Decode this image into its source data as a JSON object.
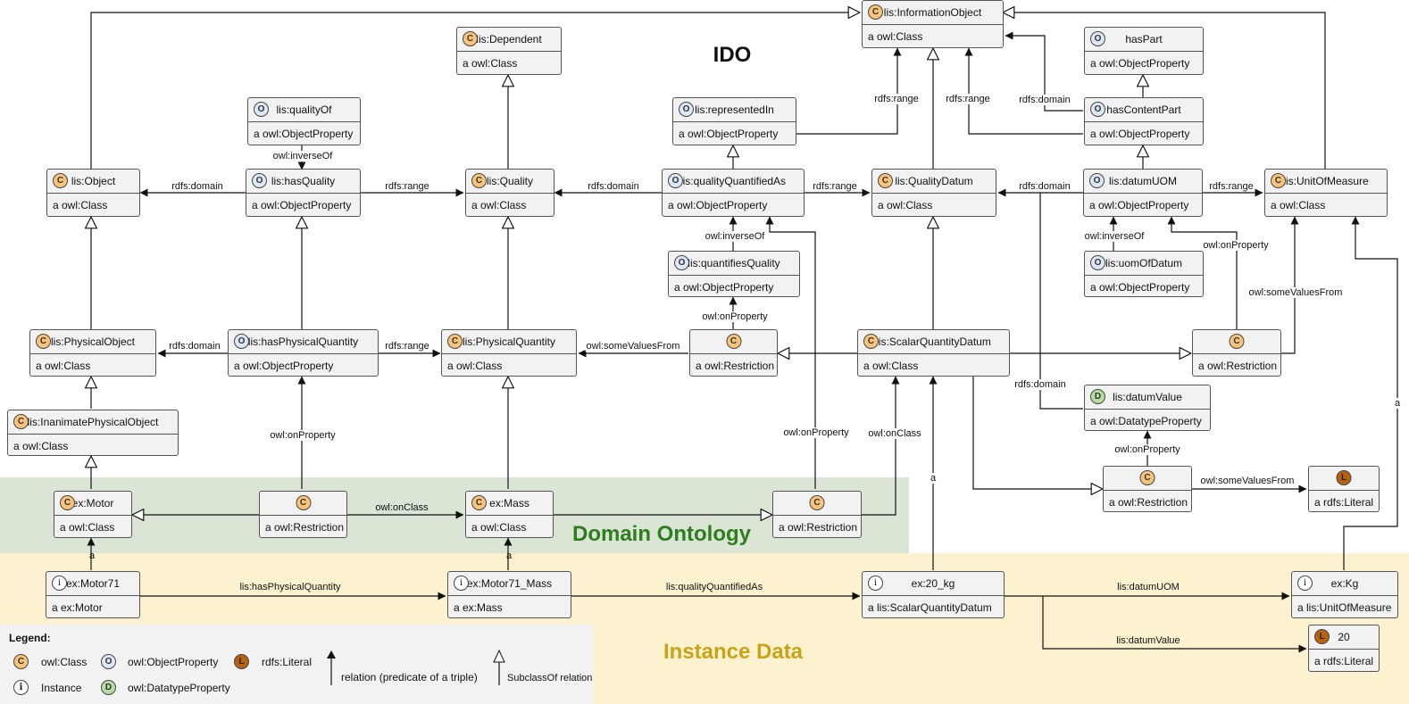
{
  "titles": {
    "ido": "IDO",
    "domain": "Domain Ontology",
    "instance": "Instance Data"
  },
  "colors": {
    "class": "#f9c479",
    "object_property": "#dce7f7",
    "literal": "#b8620f",
    "datatype_property": "#b5dea0",
    "domain_region": "#dae5d6",
    "instance_region": "#fdf2cf",
    "legend_region": "#f2f2f2"
  },
  "nodes": {
    "information_object": {
      "badge": "C",
      "name": "lis:InformationObject",
      "type": "a owl:Class"
    },
    "dependent": {
      "badge": "C",
      "name": "lis:Dependent",
      "type": "a owl:Class"
    },
    "has_part": {
      "badge": "O",
      "name": "hasPart",
      "type": "a owl:ObjectProperty"
    },
    "quality_of": {
      "badge": "O",
      "name": "lis:qualityOf",
      "type": "a owl:ObjectProperty"
    },
    "represented_in": {
      "badge": "O",
      "name": "lis:representedIn",
      "type": "a owl:ObjectProperty"
    },
    "has_content_part": {
      "badge": "O",
      "name": "hasContentPart",
      "type": "a owl:ObjectProperty"
    },
    "object": {
      "badge": "C",
      "name": "lis:Object",
      "type": "a owl:Class"
    },
    "has_quality": {
      "badge": "O",
      "name": "lis:hasQuality",
      "type": "a owl:ObjectProperty"
    },
    "quality": {
      "badge": "C",
      "name": "lis:Quality",
      "type": "a owl:Class"
    },
    "quality_quantified_as": {
      "badge": "O",
      "name": "lis:qualityQuantifiedAs",
      "type": "a owl:ObjectProperty"
    },
    "quality_datum": {
      "badge": "C",
      "name": "lis:QualityDatum",
      "type": "a owl:Class"
    },
    "datum_uom": {
      "badge": "O",
      "name": "lis:datumUOM",
      "type": "a owl:ObjectProperty"
    },
    "unit_of_measure": {
      "badge": "C",
      "name": "lis:UnitOfMeasure",
      "type": "a owl:Class"
    },
    "quantifies_quality": {
      "badge": "O",
      "name": "lis:quantifiesQuality",
      "type": "a owl:ObjectProperty"
    },
    "uom_of_datum": {
      "badge": "O",
      "name": "lis:uomOfDatum",
      "type": "a owl:ObjectProperty"
    },
    "physical_object": {
      "badge": "C",
      "name": "lis:PhysicalObject",
      "type": "a owl:Class"
    },
    "has_physical_quantity": {
      "badge": "O",
      "name": "lis:hasPhysicalQuantity",
      "type": "a owl:ObjectProperty"
    },
    "physical_quantity": {
      "badge": "C",
      "name": "lis:PhysicalQuantity",
      "type": "a owl:Class"
    },
    "restriction_pq": {
      "badge": "C",
      "name": "",
      "type": "a owl:Restriction"
    },
    "scalar_quantity_datum": {
      "badge": "C",
      "name": "lis:ScalarQuantityDatum",
      "type": "a owl:Class"
    },
    "restriction_uom": {
      "badge": "C",
      "name": "",
      "type": "a owl:Restriction"
    },
    "datum_value": {
      "badge": "D",
      "name": "lis:datumValue",
      "type": "a owl:DatatypeProperty"
    },
    "inanimate_physical_object": {
      "badge": "C",
      "name": "lis:InanimatePhysicalObject",
      "type": "a owl:Class"
    },
    "restriction_literal": {
      "badge": "C",
      "name": "",
      "type": "a owl:Restriction"
    },
    "literal_class": {
      "badge": "L",
      "name": "",
      "type": "a rdfs:Literal"
    },
    "motor": {
      "badge": "C",
      "name": "ex:Motor",
      "type": "a owl:Class"
    },
    "restriction_motor": {
      "badge": "C",
      "name": "",
      "type": "a owl:Restriction"
    },
    "mass": {
      "badge": "C",
      "name": "ex:Mass",
      "type": "a owl:Class"
    },
    "restriction_mass": {
      "badge": "C",
      "name": "",
      "type": "a owl:Restriction"
    },
    "motor71": {
      "badge": "i",
      "name": "ex:Motor71",
      "type": "a ex:Motor"
    },
    "motor71_mass": {
      "badge": "i",
      "name": "ex:Motor71_Mass",
      "type": "a ex:Mass"
    },
    "kg20": {
      "badge": "i",
      "name": "ex:20_kg",
      "type": "a lis:ScalarQuantityDatum"
    },
    "kg": {
      "badge": "i",
      "name": "ex:Kg",
      "type": "a lis:UnitOfMeasure"
    },
    "value20": {
      "badge": "L",
      "name": "20",
      "type": "a rdfs:Literal"
    }
  },
  "edge_labels": {
    "rdfs_domain": "rdfs:domain",
    "rdfs_range": "rdfs:range",
    "owl_inverse_of": "owl:inverseOf",
    "owl_on_property": "owl:onProperty",
    "owl_some_values_from": "owl:someValuesFrom",
    "owl_on_class": "owl:onClass",
    "a": "a",
    "lis_has_physical_quantity": "lis:hasPhysicalQuantity",
    "lis_quality_quantified_as": "lis:qualityQuantifiedAs",
    "lis_datum_uom": "lis:datumUOM",
    "lis_datum_value": "lis:datumValue"
  },
  "legend": {
    "title": "Legend:",
    "class": "owl:Class",
    "object_property": "owl:ObjectProperty",
    "literal": "rdfs:Literal",
    "instance": "Instance",
    "datatype_property": "owl:DatatypeProperty",
    "relation": "relation (predicate of a triple)",
    "subclass": "SubclassOf relation",
    "badges": {
      "class": "C",
      "object_property": "O",
      "literal": "L",
      "instance": "i",
      "datatype_property": "D"
    }
  }
}
